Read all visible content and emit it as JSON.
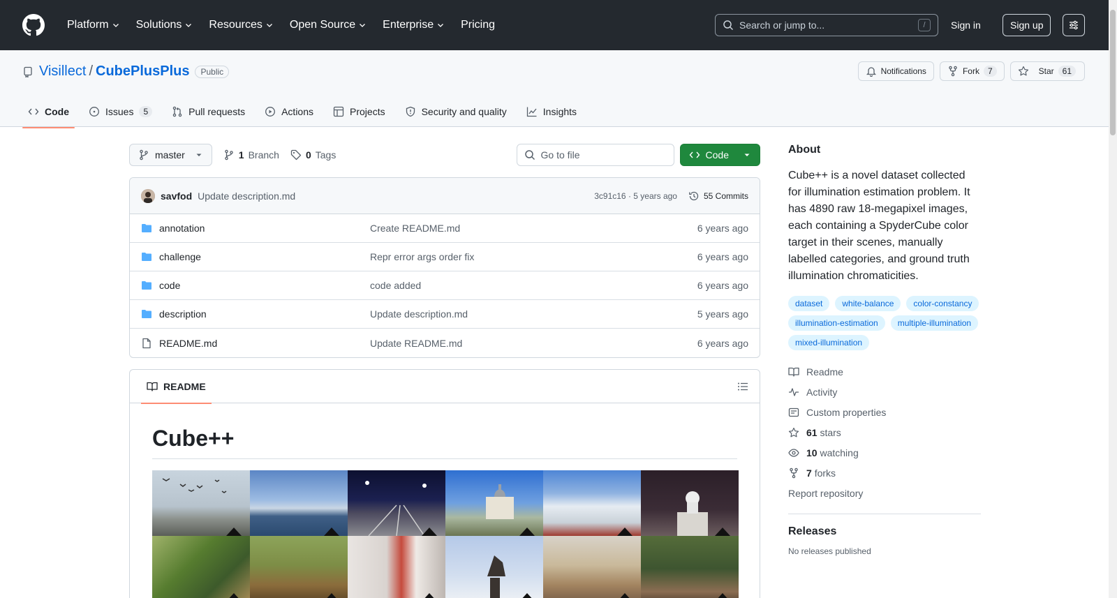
{
  "header": {
    "nav": [
      {
        "label": "Platform"
      },
      {
        "label": "Solutions"
      },
      {
        "label": "Resources"
      },
      {
        "label": "Open Source"
      },
      {
        "label": "Enterprise"
      },
      {
        "label": "Pricing"
      }
    ],
    "search_placeholder": "Search or jump to...",
    "search_shortcut": "/",
    "signin": "Sign in",
    "signup": "Sign up"
  },
  "repo": {
    "owner": "Visillect",
    "separator": "/",
    "name": "CubePlusPlus",
    "visibility": "Public",
    "notifications": "Notifications",
    "fork_label": "Fork",
    "fork_count": "7",
    "star_label": "Star",
    "star_count": "61"
  },
  "tabs": [
    {
      "label": "Code"
    },
    {
      "label": "Issues",
      "count": "5"
    },
    {
      "label": "Pull requests"
    },
    {
      "label": "Actions"
    },
    {
      "label": "Projects"
    },
    {
      "label": "Security and quality"
    },
    {
      "label": "Insights"
    }
  ],
  "toolbar": {
    "branch": "master",
    "branches_count": "1",
    "branches_label": "Branch",
    "tags_count": "0",
    "tags_label": "Tags",
    "goto_placeholder": "Go to file",
    "code_label": "Code"
  },
  "commit": {
    "author": "savfod",
    "message": "Update description.md",
    "sha_age": "3c91c16 · 5 years ago",
    "count_label": "55 Commits"
  },
  "files": [
    {
      "name": "annotation",
      "type": "dir",
      "message": "Create README.md",
      "age": "6 years ago"
    },
    {
      "name": "challenge",
      "type": "dir",
      "message": "Repr error args order fix",
      "age": "6 years ago"
    },
    {
      "name": "code",
      "type": "dir",
      "message": "code added",
      "age": "6 years ago"
    },
    {
      "name": "description",
      "type": "dir",
      "message": "Update description.md",
      "age": "5 years ago"
    },
    {
      "name": "README.md",
      "type": "file",
      "message": "Update README.md",
      "age": "6 years ago"
    }
  ],
  "readme": {
    "tab_label": "README",
    "title": "Cube++"
  },
  "about": {
    "heading": "About",
    "description": "Cube++ is a novel dataset collected for illumination estimation problem. It has 4890 raw 18-megapixel images, each containing a SpyderCube color target in their scenes, manually labelled categories, and ground truth illumination chromaticities.",
    "topics": [
      "dataset",
      "white-balance",
      "color-constancy",
      "illumination-estimation",
      "multiple-illumination",
      "mixed-illumination"
    ],
    "links": {
      "readme": "Readme",
      "activity": "Activity",
      "custom_properties": "Custom properties",
      "stars_count": "61",
      "stars_label": "stars",
      "watching_count": "10",
      "watching_label": "watching",
      "forks_count": "7",
      "forks_label": "forks"
    },
    "report": "Report repository"
  },
  "releases": {
    "heading": "Releases",
    "none": "No releases published"
  },
  "colors": {
    "header_bg": "#24292f",
    "link": "#0969da",
    "green": "#1f883d",
    "tab_underline": "#fd8c73",
    "topic_bg": "#ddf4ff"
  }
}
